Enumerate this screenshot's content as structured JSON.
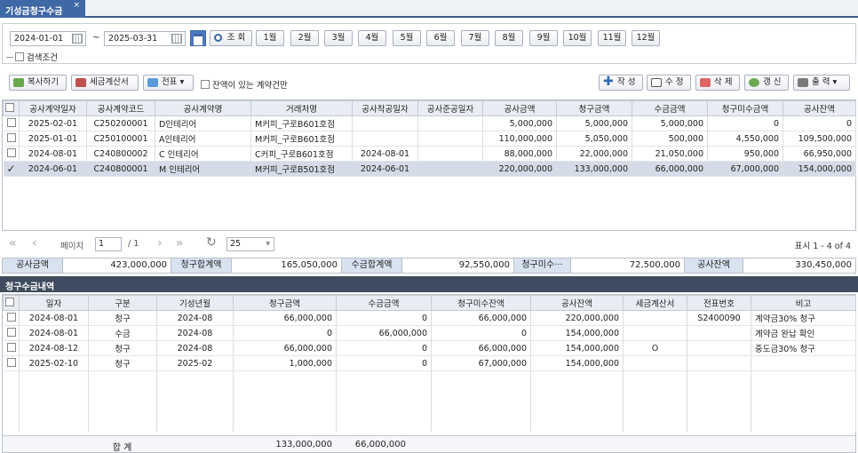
{
  "tab": {
    "title": "기성금청구수금",
    "close": "×"
  },
  "search": {
    "date_from": "2024-01-01",
    "tilde": "~",
    "date_to": "2025-03-31",
    "query_btn": "조 회",
    "months": [
      "1월",
      "2월",
      "3월",
      "4월",
      "5월",
      "6월",
      "7월",
      "8월",
      "9월",
      "10월",
      "11월",
      "12월"
    ],
    "cond_label": "검색조건"
  },
  "toolbar": {
    "copy": "복사하기",
    "tax": "세금계산서",
    "voucher": "전표",
    "balance_only": "잔액이 있는 계약건만",
    "write": "작 성",
    "edit": "수 정",
    "delete": "삭 제",
    "refresh": "갱 신",
    "print": "출 력"
  },
  "colors": {
    "accent": "#3f68a6",
    "header_bg": "#e9edf3",
    "selected_row": "#d5dbe6",
    "section_bar": "#3f4b5e"
  },
  "contracts": {
    "columns": [
      "공사계약일자",
      "공사계약코드",
      "공사계약명",
      "거래처명",
      "공사착공일자",
      "공사준공일자",
      "공사금액",
      "청구금액",
      "수금금액",
      "청구미수금액",
      "공사잔액"
    ],
    "rows": [
      {
        "date": "2025-02-01",
        "code": "C250200001",
        "name": "D인테리어",
        "client": "M커피_구로B601호점",
        "start": "",
        "end": "",
        "amount": "5,000,000",
        "billed": "5,000,000",
        "received": "5,000,000",
        "unpaid": "0",
        "balance": "0",
        "checked": false
      },
      {
        "date": "2025-01-01",
        "code": "C250100001",
        "name": "A인테리어",
        "client": "M커피_구로B601호점",
        "start": "",
        "end": "",
        "amount": "110,000,000",
        "billed": "5,050,000",
        "received": "500,000",
        "unpaid": "4,550,000",
        "balance": "109,500,000",
        "checked": false
      },
      {
        "date": "2024-08-01",
        "code": "C240800002",
        "name": "C 인테리어",
        "client": "C커피_구로B601호점",
        "start": "2024-08-01",
        "end": "",
        "amount": "88,000,000",
        "billed": "22,000,000",
        "received": "21,050,000",
        "unpaid": "950,000",
        "balance": "66,950,000",
        "checked": false
      },
      {
        "date": "2024-06-01",
        "code": "C240800001",
        "name": "M 인테리어",
        "client": "M커피_구로B501호점",
        "start": "2024-06-01",
        "end": "",
        "amount": "220,000,000",
        "billed": "133,000,000",
        "received": "66,000,000",
        "unpaid": "67,000,000",
        "balance": "154,000,000",
        "checked": true
      }
    ]
  },
  "pager": {
    "page_label": "페이지",
    "page": "1",
    "of": "/ 1",
    "page_size": "25",
    "display": "표시 1 - 4 of 4"
  },
  "totals": {
    "amount_label": "공사금액",
    "amount": "423,000,000",
    "billed_label": "청구합계액",
    "billed": "165,050,000",
    "received_label": "수금합계액",
    "received": "92,550,000",
    "unpaid_label": "청구미수···",
    "unpaid": "72,500,000",
    "balance_label": "공사잔액",
    "balance": "330,450,000"
  },
  "detail": {
    "title": "청구수금내역",
    "columns": [
      "일자",
      "구분",
      "기성년월",
      "청구금액",
      "수금금액",
      "청구미수잔액",
      "공사잔액",
      "세금계산서",
      "전표번호",
      "비고"
    ],
    "rows": [
      {
        "date": "2024-08-01",
        "type": "청구",
        "ym": "2024-08",
        "billed": "66,000,000",
        "received": "0",
        "unpaid": "66,000,000",
        "balance": "220,000,000",
        "tax": "",
        "voucher": "S2400090",
        "note": "계약금30% 청구"
      },
      {
        "date": "2024-08-01",
        "type": "수금",
        "ym": "2024-08",
        "billed": "0",
        "received": "66,000,000",
        "unpaid": "0",
        "balance": "154,000,000",
        "tax": "",
        "voucher": "",
        "note": "계약금 완납 확인"
      },
      {
        "date": "2024-08-12",
        "type": "청구",
        "ym": "2024-08",
        "billed": "66,000,000",
        "received": "0",
        "unpaid": "66,000,000",
        "balance": "154,000,000",
        "tax": "O",
        "voucher": "",
        "note": "중도금30% 청구"
      },
      {
        "date": "2025-02-10",
        "type": "청구",
        "ym": "2025-02",
        "billed": "1,000,000",
        "received": "0",
        "unpaid": "67,000,000",
        "balance": "154,000,000",
        "tax": "",
        "voucher": "",
        "note": ""
      }
    ],
    "footer": {
      "label": "합 계",
      "billed": "133,000,000",
      "received": "66,000,000"
    }
  }
}
